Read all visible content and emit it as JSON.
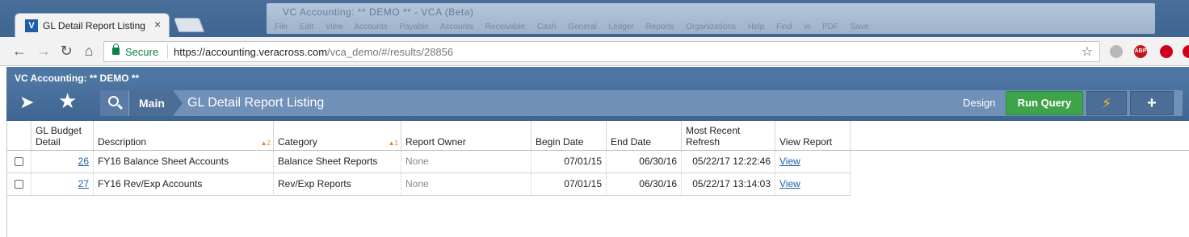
{
  "browser": {
    "tab_title": "GL Detail Report Listing",
    "tab_close": "×",
    "window_title": "VC Accounting: ** DEMO ** - VCA (Beta)",
    "window_menu": "File Edit View Accounts Payable Accounts Receivable Cash General Ledger Reports Organizations Help Find in PDF Save",
    "secure_label": "Secure",
    "url_base": "https://accounting.veracross.com",
    "url_path": "/vca_demo/#/results/28856",
    "ext_abp": "ABP"
  },
  "app": {
    "title": "VC Accounting: ** DEMO **",
    "breadcrumb_main": "Main",
    "breadcrumb_current": "GL Detail Report Listing",
    "design_label": "Design",
    "run_query_label": "Run Query",
    "add_label": "+"
  },
  "grid": {
    "columns": [
      {
        "key": "gl",
        "label": "GL Budget Detail",
        "line1": "GL Budget",
        "line2": "Detail"
      },
      {
        "key": "desc",
        "label": "Description",
        "sort": "2"
      },
      {
        "key": "cat",
        "label": "Category",
        "sort": "1"
      },
      {
        "key": "owner",
        "label": "Report Owner"
      },
      {
        "key": "begin",
        "label": "Begin Date"
      },
      {
        "key": "end",
        "label": "End Date"
      },
      {
        "key": "refresh",
        "label": "Most Recent Refresh",
        "line1": "Most Recent",
        "line2": "Refresh"
      },
      {
        "key": "view",
        "label": "View Report"
      }
    ],
    "rows": [
      {
        "gl": "26",
        "desc": "FY16 Balance Sheet Accounts",
        "cat": "Balance Sheet Reports",
        "owner": "None",
        "begin": "07/01/15",
        "end": "06/30/16",
        "refresh": "05/22/17 12:22:46",
        "view": "View"
      },
      {
        "gl": "27",
        "desc": "FY16 Rev/Exp Accounts",
        "cat": "Rev/Exp Reports",
        "owner": "None",
        "begin": "07/01/15",
        "end": "06/30/16",
        "refresh": "05/22/17 13:14:03",
        "view": "View"
      }
    ]
  },
  "colors": {
    "accent": "#4e76a3",
    "run_query": "#3fa34a",
    "link": "#1f5fa8"
  }
}
